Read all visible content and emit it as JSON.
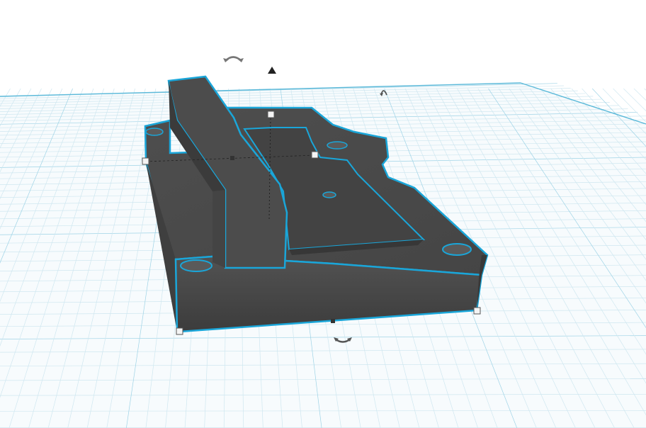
{
  "app": {
    "view": "3d-workplane",
    "selected_object": "dark-grey-enclosure-part",
    "colors": {
      "background": "#ffffff",
      "grid_line": "#cfe7f0",
      "grid_major": "#9ed3e6",
      "grid_edge": "#5bb9d9",
      "part_face": "#4a4a4a",
      "part_dark": "#3a3a3a",
      "part_light": "#5a5a5a",
      "selection_outline": "#1aa6d9",
      "handle_fill": "#f4f4f4",
      "handle_stroke": "#555555",
      "gizmo": "#333333"
    }
  },
  "gizmos": {
    "rotate_top": "rotate-arc-icon",
    "lift": "up-arrow-icon",
    "rotate_right": "rotate-arc-small-icon",
    "rotate_bottom": "rotate-arc-icon"
  }
}
